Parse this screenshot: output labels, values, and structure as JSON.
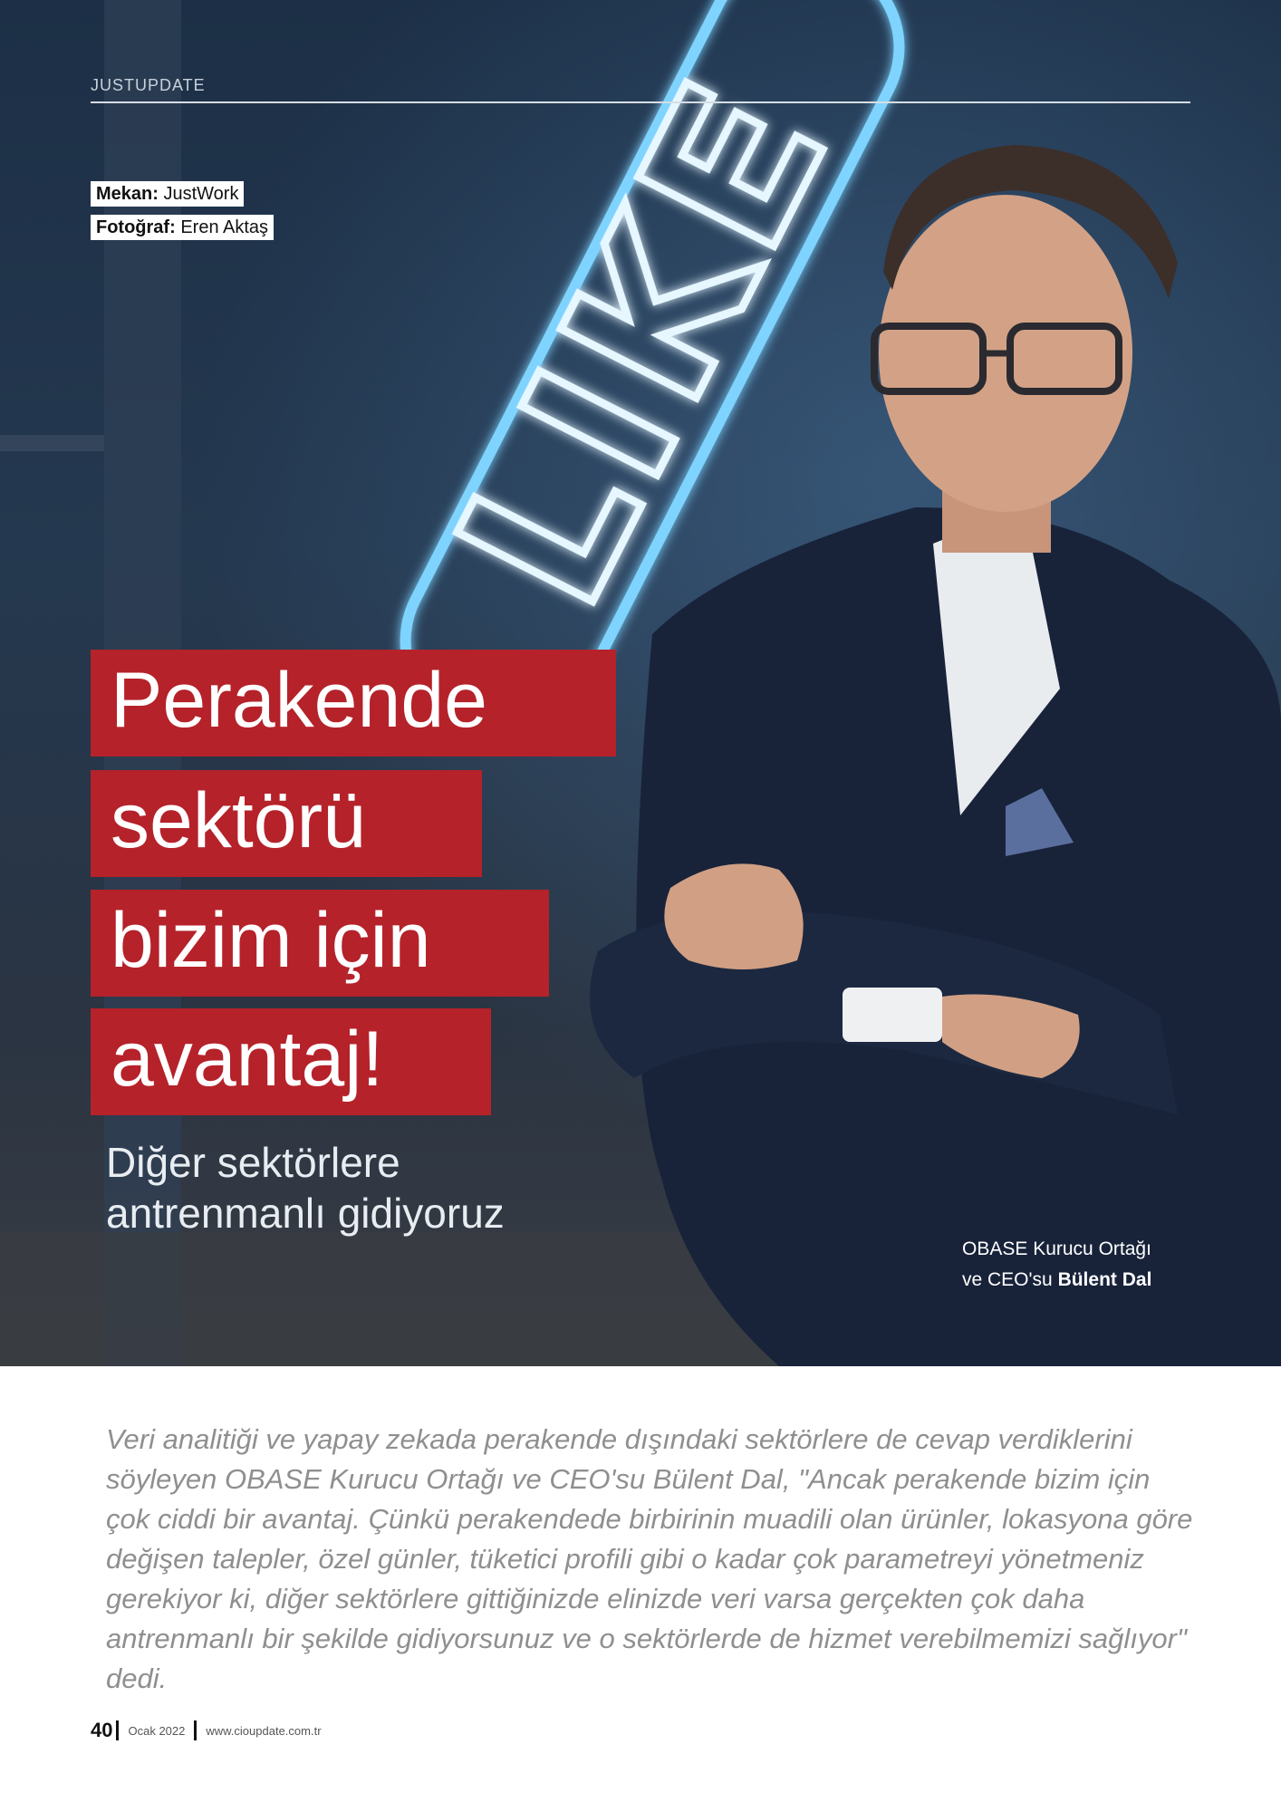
{
  "header": {
    "section": "JUSTUPDATE"
  },
  "credits": {
    "venue_label": "Mekan:",
    "venue_value": "JustWork",
    "photo_label": "Fotoğraf:",
    "photo_value": "Eren Aktaş"
  },
  "hero": {
    "neon_text": "LIKE",
    "headline": [
      "Perakende",
      "sektörü",
      "bizim için",
      "avantaj!"
    ],
    "subheading": "Diğer sektörlere antrenmanlı gidiyoruz",
    "caption_line1": "OBASE Kurucu Ortağı",
    "caption_line2_prefix": "ve CEO'su",
    "caption_name": "Bülent Dal"
  },
  "lede": "Veri analitiği ve yapay zekada perakende dışındaki sektörlere de cevap verdiklerini söyleyen OBASE Kurucu Ortağı ve CEO'su Bülent Dal, \"Ancak perakende bizim için çok ciddi bir avantaj. Çünkü perakendede birbirinin muadili olan ürünler, lokasyona göre değişen talepler, özel günler, tüketici profili gibi o kadar çok parametreyi yönetmeniz gerekiyor ki, diğer sektörlere gittiğinizde elinizde veri varsa gerçekten çok daha antrenmanlı bir şekilde gidiyorsunuz ve o sektörlerde de hizmet verebilmemizi sağlıyor\" dedi.",
  "footer": {
    "page": "40",
    "date": "Ocak 2022",
    "url": "www.cioupdate.com.tr"
  },
  "colors": {
    "accent": "#b5222a",
    "neon": "#7fd4ff"
  }
}
